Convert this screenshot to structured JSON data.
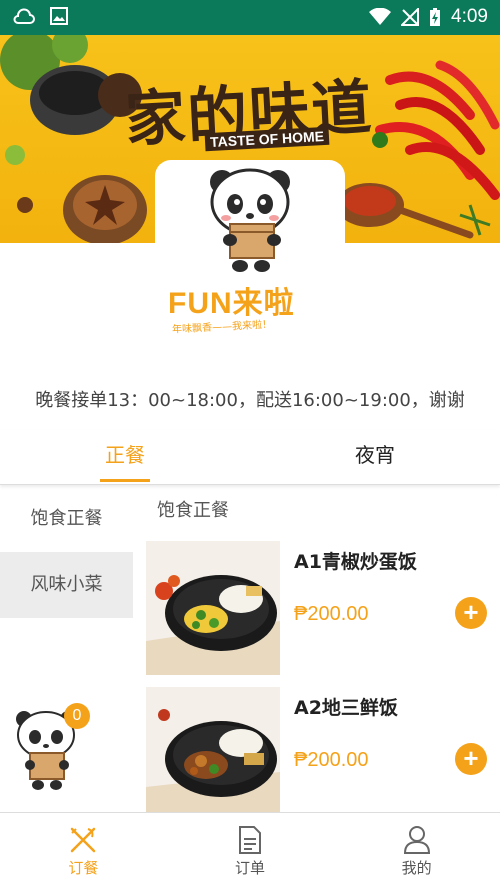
{
  "status_bar": {
    "time": "4:09"
  },
  "banner": {
    "title": "家的味道",
    "subtitle": "TASTE OF HOME"
  },
  "brand": {
    "name": "FUN来啦",
    "slogan": "年味飘香——我来啦！"
  },
  "notice": "晚餐接单13：00~18:00，配送16:00~19:00，谢谢",
  "tabs": [
    {
      "label": "正餐",
      "active": true
    },
    {
      "label": "夜宵",
      "active": false
    }
  ],
  "categories": [
    {
      "label": "饱食正餐",
      "active": false
    },
    {
      "label": "风味小菜",
      "active": true
    }
  ],
  "section_title": "饱食正餐",
  "dishes": [
    {
      "name": "A1青椒炒蛋饭",
      "price": "₱200.00"
    },
    {
      "name": "A2地三鲜饭",
      "price": "₱200.00"
    }
  ],
  "cart": {
    "count": "0"
  },
  "bottom_nav": [
    {
      "label": "订餐",
      "icon": "utensils-icon",
      "active": true
    },
    {
      "label": "订单",
      "icon": "document-icon",
      "active": false
    },
    {
      "label": "我的",
      "icon": "user-icon",
      "active": false
    }
  ],
  "colors": {
    "accent": "#f5a21b",
    "status_bar": "#0b7a5a",
    "banner": "#f7c21a"
  }
}
